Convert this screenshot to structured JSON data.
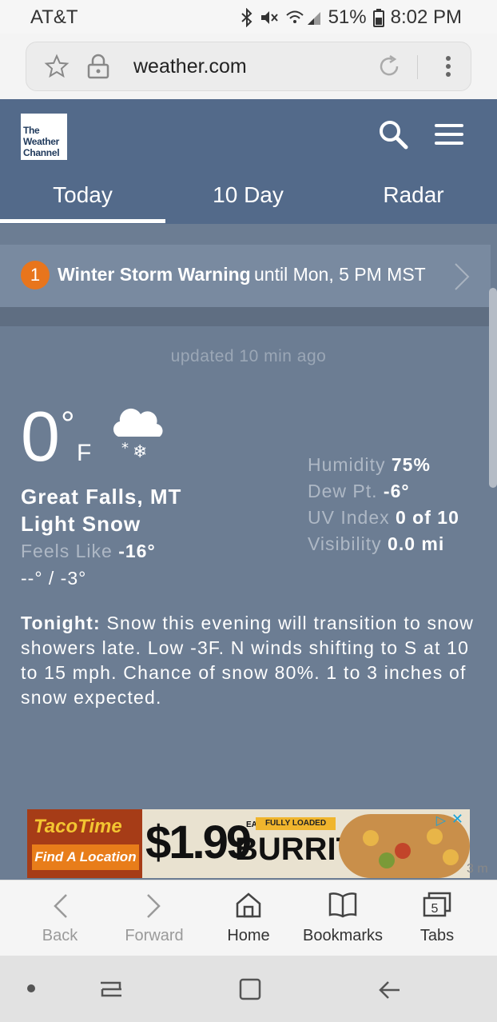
{
  "status_bar": {
    "carrier": "AT&T",
    "battery": "51%",
    "time": "8:02 PM"
  },
  "browser": {
    "url": "weather.com"
  },
  "site": {
    "logo_lines": [
      "The",
      "Weather",
      "Channel"
    ],
    "tabs": [
      {
        "label": "Today",
        "active": true
      },
      {
        "label": "10 Day",
        "active": false
      },
      {
        "label": "Radar",
        "active": false
      }
    ]
  },
  "alert": {
    "count": "1",
    "title": "Winter Storm Warning",
    "until": "until Mon, 5 PM MST"
  },
  "current": {
    "updated": "updated 10 min ago",
    "temperature": "0",
    "degree_symbol": "°",
    "unit": "F",
    "location": "Great Falls, MT",
    "condition": "Light Snow",
    "feels_like_label": "Feels Like",
    "feels_like_value": "-16°",
    "hi_lo": "--° / -3°",
    "humidity_label": "Humidity",
    "humidity_value": "75%",
    "dew_point_label": "Dew Pt.",
    "dew_point_value": "-6°",
    "uv_label": "UV Index",
    "uv_value": "0 of 10",
    "visibility_label": "Visibility",
    "visibility_value": "0.0 mi",
    "icon": "cloud-snow-icon"
  },
  "forecast": {
    "tonight_label": "Tonight:",
    "tonight_text": "Snow this evening will transition to snow showers late. Low -3F. N winds shifting to S at 10 to 15 mph. Chance of snow 80%. 1 to 3 inches of snow expected."
  },
  "ad": {
    "brand": "TacoTime",
    "find_location": "Find A Location",
    "price": "$1.99",
    "price_suffix": "EA.",
    "tagline": "FULLY LOADED",
    "product": "BURRITO",
    "peek_text": "3 m"
  },
  "bottom_nav": {
    "items": [
      {
        "label": "Back",
        "enabled": false
      },
      {
        "label": "Forward",
        "enabled": false
      },
      {
        "label": "Home",
        "enabled": true
      },
      {
        "label": "Bookmarks",
        "enabled": true
      },
      {
        "label": "Tabs",
        "enabled": true
      }
    ],
    "tabs_count": "5"
  },
  "colors": {
    "header_bg": "#536a8a",
    "content_bg": "#6c7d93",
    "alert_badge": "#e8751c"
  }
}
